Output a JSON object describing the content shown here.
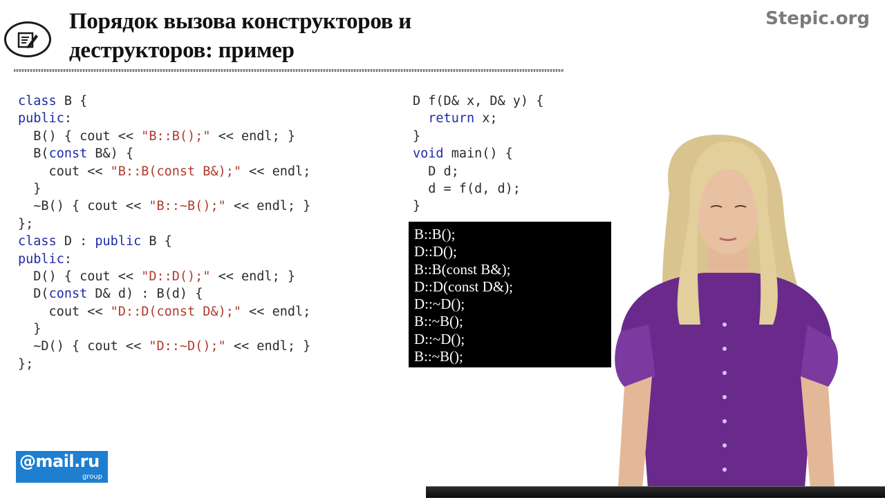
{
  "header": {
    "title_lines": [
      "Порядок вызова конструкторов и",
      "деструкторов: пример"
    ],
    "brand": "Stepic.org",
    "icon": "notepad-pencil-icon"
  },
  "code_left": [
    [
      {
        "t": "class",
        "c": "kw"
      },
      {
        "t": " B {"
      }
    ],
    [
      {
        "t": "public",
        "c": "kw"
      },
      {
        "t": ":"
      }
    ],
    [
      {
        "t": "  B() { cout << "
      },
      {
        "t": "\"B::B();\"",
        "c": "str"
      },
      {
        "t": " << endl; }"
      }
    ],
    [
      {
        "t": "  B("
      },
      {
        "t": "const",
        "c": "kw"
      },
      {
        "t": " B&) {"
      }
    ],
    [
      {
        "t": "    cout << "
      },
      {
        "t": "\"B::B(const B&);\"",
        "c": "str"
      },
      {
        "t": " << endl;"
      }
    ],
    [
      {
        "t": "  }"
      }
    ],
    [
      {
        "t": "  ~B() { cout << "
      },
      {
        "t": "\"B::~B();\"",
        "c": "str"
      },
      {
        "t": " << endl; }"
      }
    ],
    [
      {
        "t": "};"
      }
    ],
    [
      {
        "t": "class",
        "c": "kw"
      },
      {
        "t": " D : "
      },
      {
        "t": "public",
        "c": "kw"
      },
      {
        "t": " B {"
      }
    ],
    [
      {
        "t": "public",
        "c": "kw"
      },
      {
        "t": ":"
      }
    ],
    [
      {
        "t": "  D() { cout << "
      },
      {
        "t": "\"D::D();\"",
        "c": "str"
      },
      {
        "t": " << endl; }"
      }
    ],
    [
      {
        "t": "  D("
      },
      {
        "t": "const",
        "c": "kw"
      },
      {
        "t": " D& d) : B(d) {"
      }
    ],
    [
      {
        "t": "    cout << "
      },
      {
        "t": "\"D::D(const D&);\"",
        "c": "str"
      },
      {
        "t": " << endl;"
      }
    ],
    [
      {
        "t": "  }"
      }
    ],
    [
      {
        "t": "  ~D() { cout << "
      },
      {
        "t": "\"D::~D();\"",
        "c": "str"
      },
      {
        "t": " << endl; }"
      }
    ],
    [
      {
        "t": "};"
      }
    ]
  ],
  "code_right": [
    [
      {
        "t": "D f(D& x, D& y) {"
      }
    ],
    [
      {
        "t": "  "
      },
      {
        "t": "return",
        "c": "kw"
      },
      {
        "t": " x;"
      }
    ],
    [
      {
        "t": "}"
      }
    ],
    [
      {
        "t": "void",
        "c": "kw"
      },
      {
        "t": " main() {"
      }
    ],
    [
      {
        "t": "  D d;"
      }
    ],
    [
      {
        "t": "  d = f(d, d);"
      }
    ],
    [
      {
        "t": "}"
      }
    ]
  ],
  "console_output": [
    "B::B();",
    "D::D();",
    "B::B(const B&);",
    "D::D(const D&);",
    "D::~D();",
    "B::~B();",
    "D::~D();",
    "B::~B();"
  ],
  "logo": {
    "main": "@mail.ru",
    "sub": "group"
  },
  "colors": {
    "keyword": "#1f2aa8",
    "string": "#b03b2c",
    "console_bg": "#000000",
    "logo_bg": "#1e7fd0",
    "blouse": "#6a2a8c"
  }
}
